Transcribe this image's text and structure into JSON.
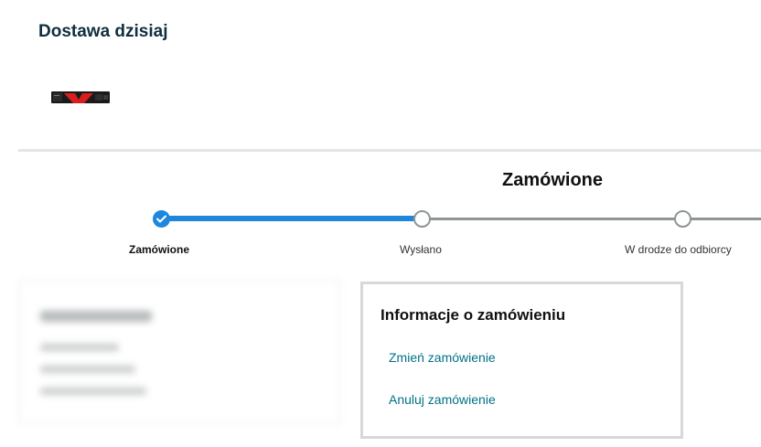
{
  "delivery": {
    "title": "Dostawa dzisiaj"
  },
  "product": {
    "thumbnail_icon": "ssd-product-thumbnail"
  },
  "tracking": {
    "current_status": "Zamówione",
    "steps": [
      {
        "label": "Zamówione",
        "state": "done"
      },
      {
        "label": "Wysłano",
        "state": "pending"
      },
      {
        "label": "W drodze do odbiorcy",
        "state": "pending"
      }
    ],
    "progress_fraction": 0.5
  },
  "order_info": {
    "title": "Informacje o zamówieniu",
    "links": [
      {
        "label": "Zmień zamówienie"
      },
      {
        "label": "Anuluj zamówienie"
      }
    ]
  },
  "colors": {
    "accent_blue": "#1f86de",
    "link_teal": "#007185",
    "pending_gray": "#8f9494",
    "card_border": "#d5d9d9"
  }
}
